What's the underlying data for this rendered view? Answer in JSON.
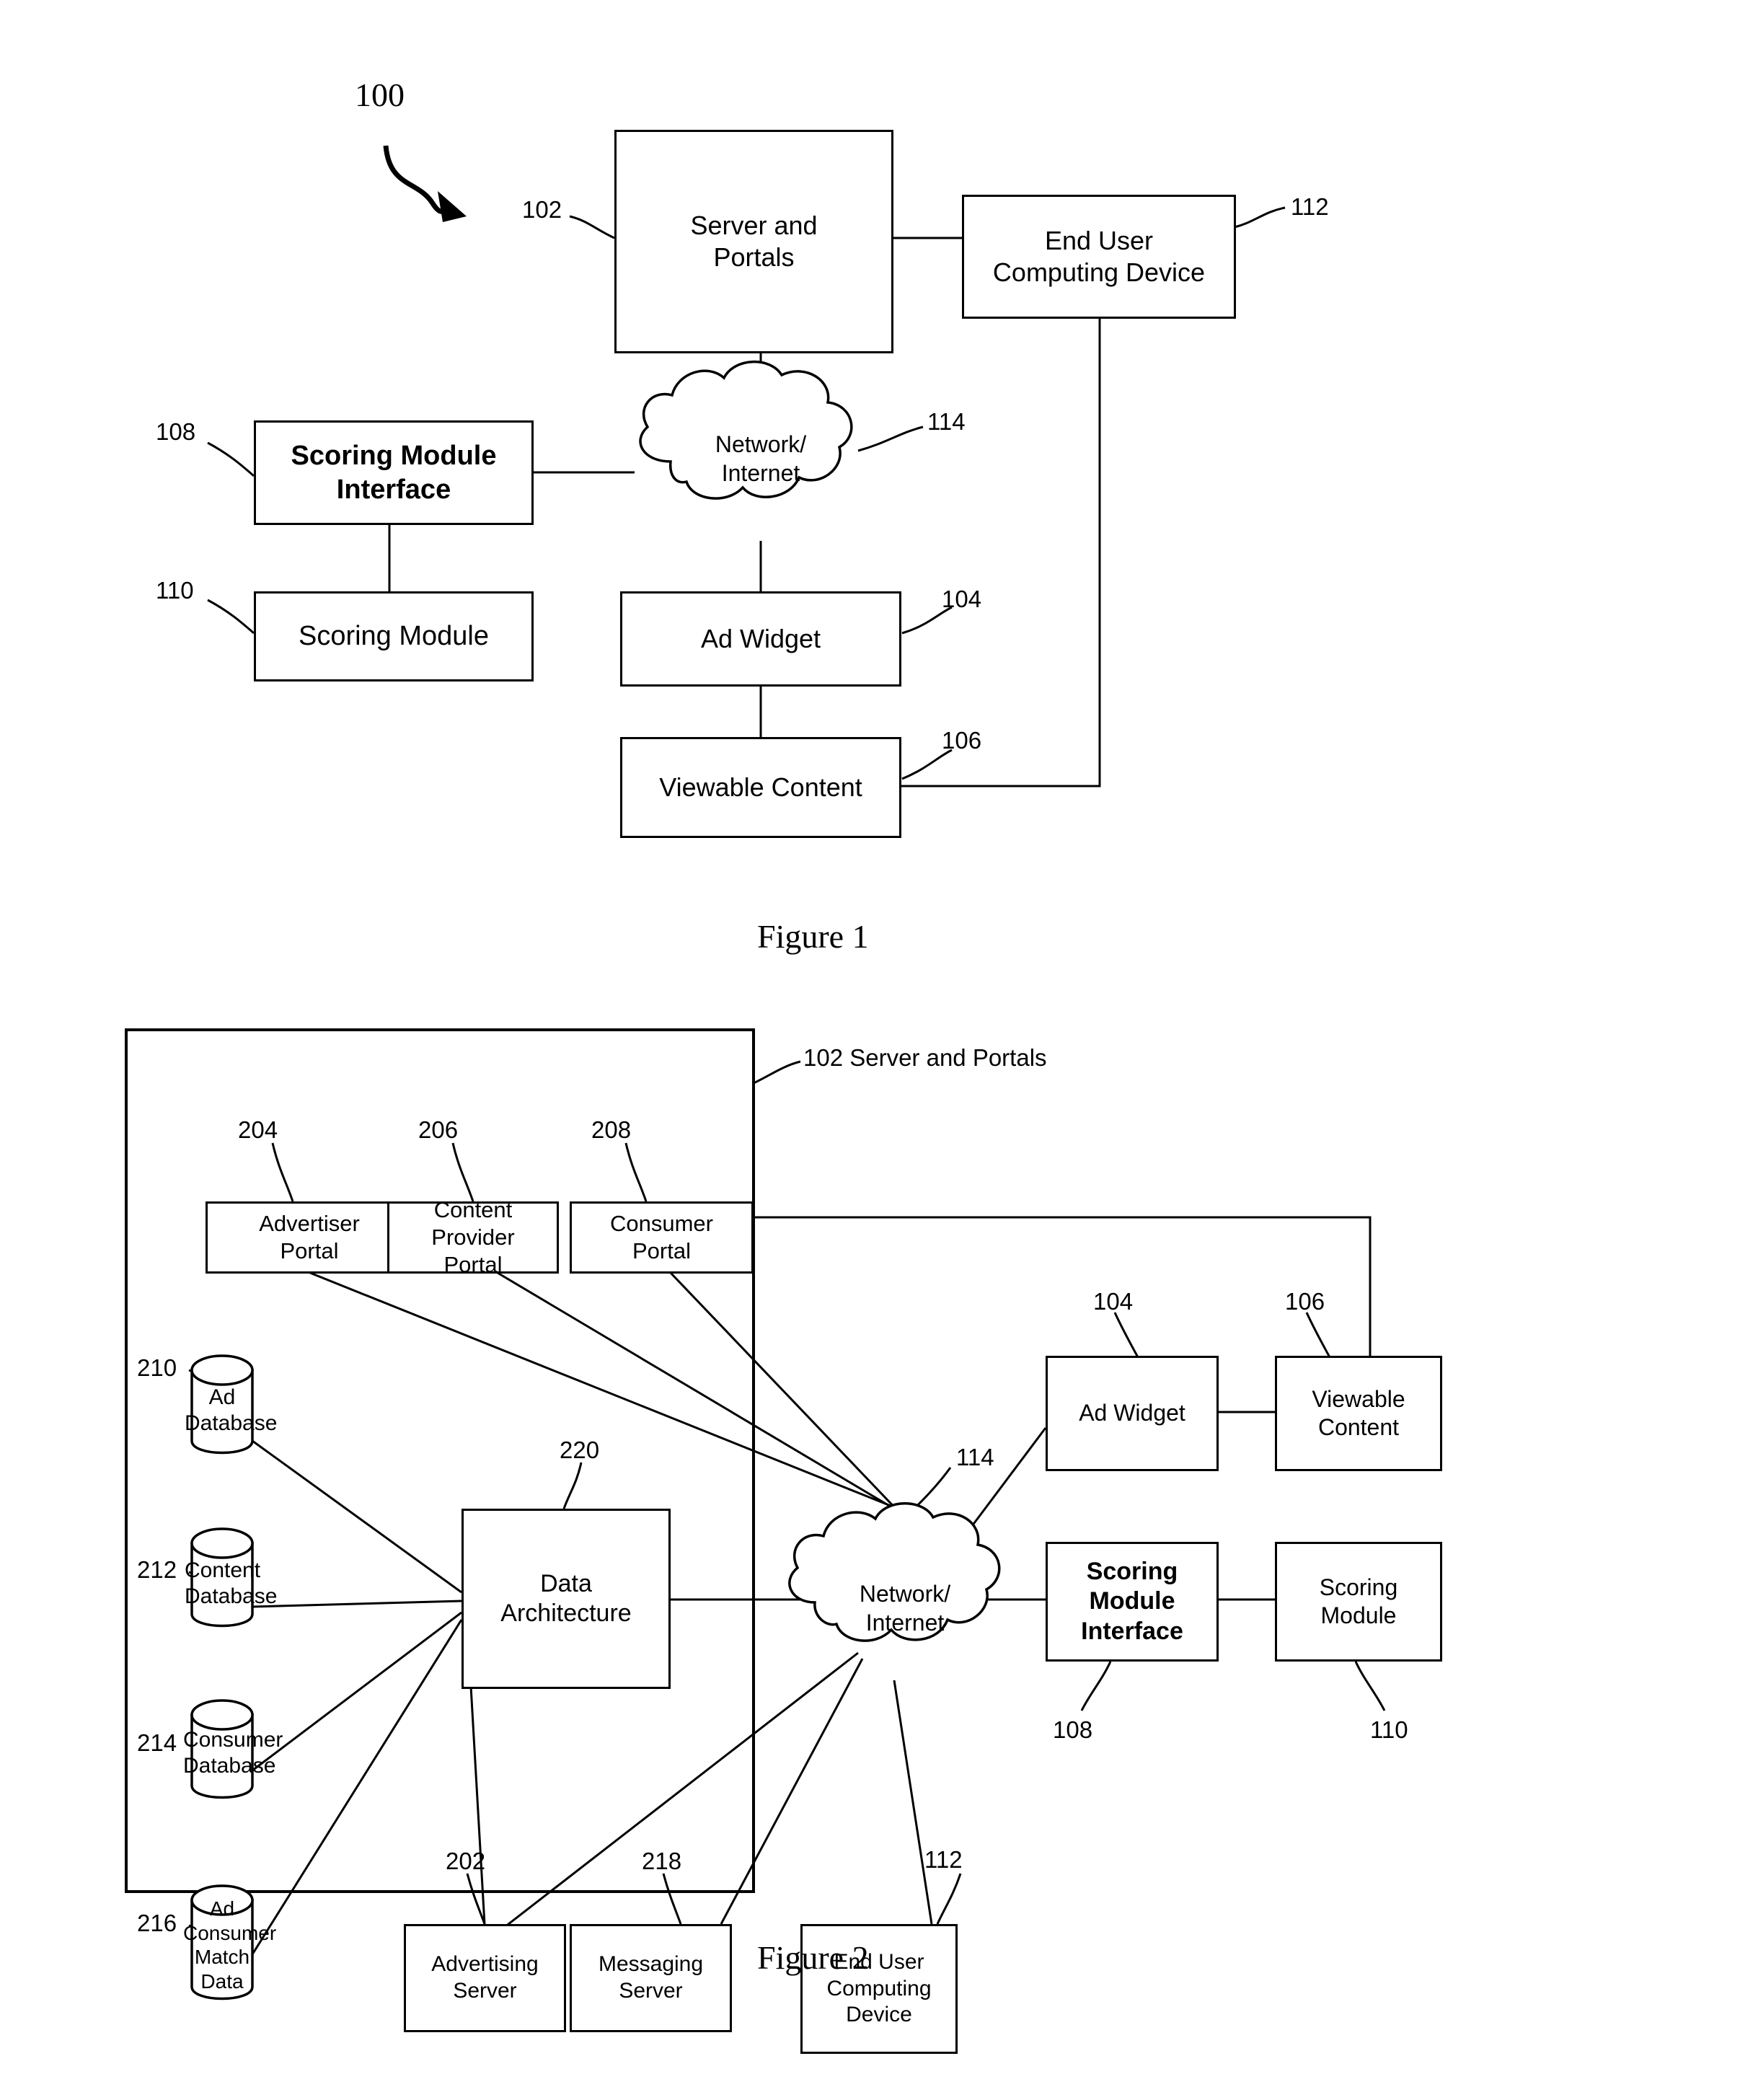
{
  "figure1": {
    "caption": "Figure 1",
    "system_ref": "100",
    "nodes": [
      {
        "id": "server_portals",
        "label": "Server and\nPortals",
        "ref": "102",
        "bold": false
      },
      {
        "id": "end_user_device",
        "label": "End User\nComputing Device",
        "ref": "112",
        "bold": false
      },
      {
        "id": "scoring_module_interface",
        "label": "Scoring Module\nInterface",
        "ref": "108",
        "bold": true
      },
      {
        "id": "scoring_module",
        "label": "Scoring Module",
        "ref": "110",
        "bold": false
      },
      {
        "id": "network_internet",
        "label": "Network/\nInternet",
        "ref": "114",
        "bold": false
      },
      {
        "id": "ad_widget",
        "label": "Ad Widget",
        "ref": "104",
        "bold": false
      },
      {
        "id": "viewable_content",
        "label": "Viewable Content",
        "ref": "106",
        "bold": false
      }
    ]
  },
  "figure2": {
    "caption": "Figure 2",
    "container_label": "102  Server and Portals",
    "nodes": [
      {
        "id": "advertiser_portal",
        "label": "Advertiser\nPortal",
        "ref": "204",
        "bold": false
      },
      {
        "id": "content_provider_portal",
        "label": "Content\nProvider\nPortal",
        "ref": "206",
        "bold": false
      },
      {
        "id": "consumer_portal",
        "label": "Consumer\nPortal",
        "ref": "208",
        "bold": false
      },
      {
        "id": "ad_database",
        "label": "Ad\nDatabase",
        "ref": "210",
        "bold": false
      },
      {
        "id": "content_database",
        "label": "Content\nDatabase",
        "ref": "212",
        "bold": false
      },
      {
        "id": "consumer_database",
        "label": "Consumer\nDatabase",
        "ref": "214",
        "bold": false
      },
      {
        "id": "ad_consumer_match_data",
        "label": "Ad\nConsumer\nMatch\nData",
        "ref": "216",
        "bold": false
      },
      {
        "id": "data_architecture",
        "label": "Data\nArchitecture",
        "ref": "220",
        "bold": false
      },
      {
        "id": "advertising_server",
        "label": "Advertising\nServer",
        "ref": "202",
        "bold": false
      },
      {
        "id": "messaging_server",
        "label": "Messaging\nServer",
        "ref": "218",
        "bold": false
      },
      {
        "id": "network_internet",
        "label": "Network/\nInternet",
        "ref": "114",
        "bold": false
      },
      {
        "id": "ad_widget",
        "label": "Ad Widget",
        "ref": "104",
        "bold": false
      },
      {
        "id": "viewable_content",
        "label": "Viewable\nContent",
        "ref": "106",
        "bold": false
      },
      {
        "id": "scoring_module_interface",
        "label": "Scoring\nModule\nInterface",
        "ref": "108",
        "bold": true
      },
      {
        "id": "scoring_module",
        "label": "Scoring\nModule",
        "ref": "110",
        "bold": false
      },
      {
        "id": "end_user_device",
        "label": "End User\nComputing\nDevice",
        "ref": "112",
        "bold": false
      }
    ]
  },
  "f1": {
    "server_portals": "Server and\nPortals",
    "end_user_device": "End User\nComputing Device",
    "scoring_module_interface": "Scoring Module\nInterface",
    "scoring_module": "Scoring Module",
    "network": "Network/\nInternet",
    "ad_widget": "Ad Widget",
    "viewable_content": "Viewable Content",
    "r100": "100",
    "r102": "102",
    "r104": "104",
    "r106": "106",
    "r108": "108",
    "r110": "110",
    "r112": "112",
    "r114": "114",
    "caption": "Figure 1"
  },
  "f2": {
    "container": "102  Server and Portals",
    "advertiser_portal": "Advertiser\nPortal",
    "content_provider_portal": "Content\nProvider\nPortal",
    "consumer_portal": "Consumer\nPortal",
    "ad_database": "Ad\nDatabase",
    "content_database": "Content\nDatabase",
    "consumer_database": "Consumer\nDatabase",
    "ad_consumer_match": "Ad\nConsumer\nMatch\nData",
    "data_architecture": "Data\nArchitecture",
    "advertising_server": "Advertising\nServer",
    "messaging_server": "Messaging\nServer",
    "network": "Network/\nInternet",
    "ad_widget": "Ad Widget",
    "viewable_content": "Viewable\nContent",
    "scoring_module_interface": "Scoring\nModule\nInterface",
    "scoring_module": "Scoring\nModule",
    "end_user_device": "End User\nComputing\nDevice",
    "r202": "202",
    "r204": "204",
    "r206": "206",
    "r208": "208",
    "r210": "210",
    "r212": "212",
    "r214": "214",
    "r216": "216",
    "r218": "218",
    "r220": "220",
    "r104": "104",
    "r106": "106",
    "r108": "108",
    "r110": "110",
    "r112": "112",
    "r114": "114",
    "caption": "Figure 2"
  }
}
